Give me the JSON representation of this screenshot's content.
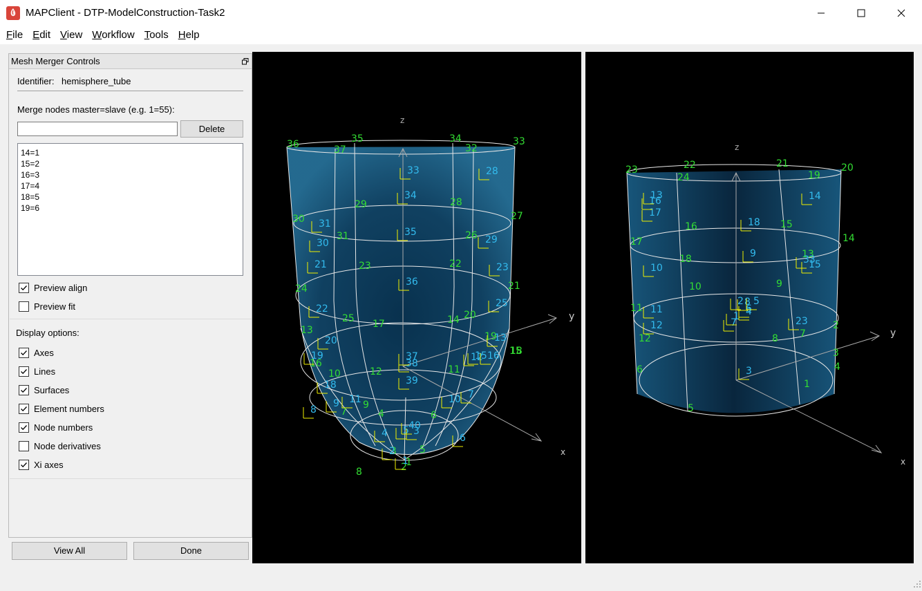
{
  "window": {
    "title": "MAPClient - DTP-ModelConstruction-Task2",
    "icon": "mapclient-logo-icon",
    "controls": [
      "minimize-icon",
      "maximize-icon",
      "close-icon"
    ]
  },
  "menu": [
    {
      "ul": "F",
      "rest": "ile"
    },
    {
      "ul": "E",
      "rest": "dit"
    },
    {
      "ul": "V",
      "rest": "iew"
    },
    {
      "ul": "W",
      "rest": "orkflow"
    },
    {
      "ul": "T",
      "rest": "ools"
    },
    {
      "ul": "H",
      "rest": "elp"
    }
  ],
  "dock": {
    "title": "Mesh Merger Controls",
    "identifier_label": "Identifier:",
    "identifier_value": "hemisphere_tube",
    "merge_label": "Merge nodes master=slave (e.g. 1=55):",
    "merge_input_value": "",
    "delete_button": "Delete",
    "merge_list": [
      "14=1",
      "15=2",
      "16=3",
      "17=4",
      "18=5",
      "19=6"
    ],
    "preview_align": {
      "label": "Preview align",
      "checked": true
    },
    "preview_fit": {
      "label": "Preview fit",
      "checked": false
    },
    "display_options_label": "Display options:",
    "display_options": [
      {
        "label": "Axes",
        "checked": true
      },
      {
        "label": "Lines",
        "checked": true
      },
      {
        "label": "Surfaces",
        "checked": true
      },
      {
        "label": "Element numbers",
        "checked": true
      },
      {
        "label": "Node numbers",
        "checked": true
      },
      {
        "label": "Node derivatives",
        "checked": false
      },
      {
        "label": "Xi axes",
        "checked": true
      }
    ],
    "view_all_button": "View All",
    "done_button": "Done"
  },
  "viewports": {
    "left": {
      "axes": {
        "z": "z",
        "y": "y",
        "x": "x"
      },
      "node_numbers": [
        "36",
        "37",
        "35",
        "34",
        "32",
        "33",
        "29",
        "28",
        "30",
        "31",
        "27",
        "26",
        "24",
        "23",
        "22",
        "21",
        "25",
        "20",
        "16",
        "15",
        "19",
        "18",
        "13",
        "12",
        "11",
        "10",
        "9",
        "8",
        "7",
        "6",
        "5",
        "4",
        "3",
        "2",
        "1",
        "17",
        "14"
      ],
      "element_numbers": [
        "33",
        "34",
        "35",
        "36",
        "37",
        "38",
        "39",
        "40",
        "31",
        "30",
        "28",
        "29",
        "22",
        "21",
        "23",
        "25",
        "20",
        "19",
        "16",
        "15",
        "18",
        "13",
        "12",
        "11",
        "10",
        "9",
        "8",
        "7",
        "6",
        "5",
        "4",
        "3",
        "2",
        "1"
      ]
    },
    "right": {
      "axes": {
        "z": "z",
        "y": "y",
        "x": "x"
      },
      "node_numbers": [
        "23",
        "22",
        "24",
        "21",
        "19",
        "20",
        "16",
        "15",
        "17",
        "14",
        "18",
        "10",
        "9",
        "13",
        "11",
        "12",
        "8",
        "7",
        "6",
        "1",
        "2",
        "3",
        "4",
        "5"
      ],
      "element_numbers": [
        "16",
        "17",
        "13",
        "10",
        "11",
        "12",
        "14",
        "15",
        "18",
        "9",
        "8",
        "6",
        "7",
        "3",
        "4",
        "5",
        "2",
        "1",
        "23",
        "33"
      ]
    }
  },
  "colors": {
    "node_label": "#33dd33",
    "element_label": "#33bbee",
    "xi_axes": "#f0f000",
    "lines": "#e8e8e8",
    "viewport_bg": "#000000"
  }
}
